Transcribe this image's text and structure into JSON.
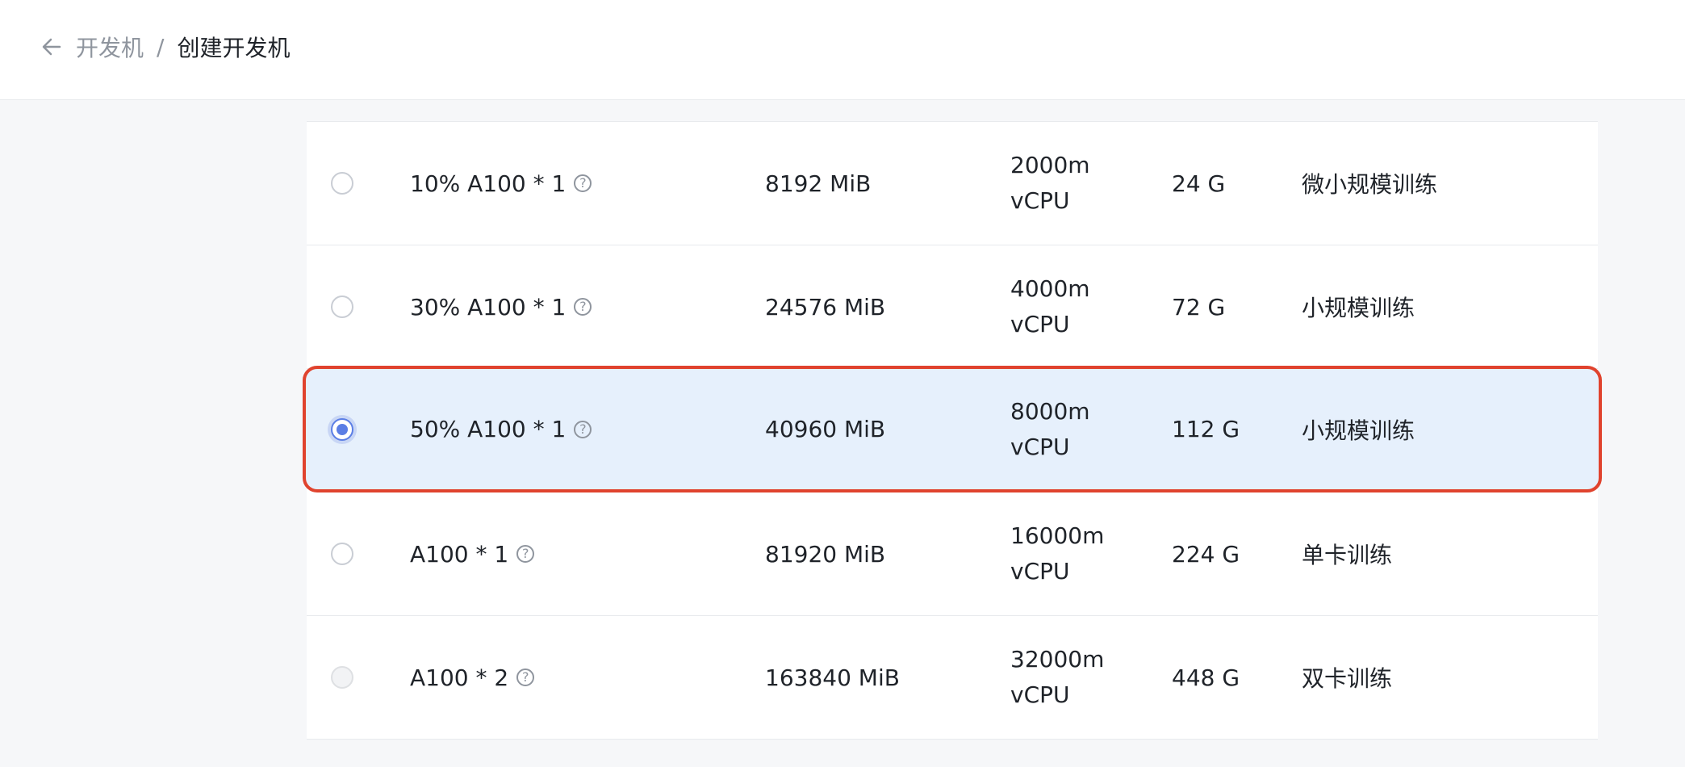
{
  "header": {
    "back_icon": "arrow-left-icon",
    "parent_label": "开发机",
    "separator": "/",
    "current_label": "创建开发机"
  },
  "rows": [
    {
      "spec": "10% A100 * 1",
      "memory": "8192 MiB",
      "cpu_line1": "2000m",
      "cpu_line2": "vCPU",
      "disk": "24 G",
      "usage": "微小规模训练",
      "selected": false,
      "disabled": false
    },
    {
      "spec": "30% A100 * 1",
      "memory": "24576 MiB",
      "cpu_line1": "4000m",
      "cpu_line2": "vCPU",
      "disk": "72 G",
      "usage": "小规模训练",
      "selected": false,
      "disabled": false
    },
    {
      "spec": "50% A100 * 1",
      "memory": "40960 MiB",
      "cpu_line1": "8000m",
      "cpu_line2": "vCPU",
      "disk": "112 G",
      "usage": "小规模训练",
      "selected": true,
      "disabled": false
    },
    {
      "spec": "A100 * 1",
      "memory": "81920 MiB",
      "cpu_line1": "16000m",
      "cpu_line2": "vCPU",
      "disk": "224 G",
      "usage": "单卡训练",
      "selected": false,
      "disabled": false
    },
    {
      "spec": "A100 * 2",
      "memory": "163840 MiB",
      "cpu_line1": "32000m",
      "cpu_line2": "vCPU",
      "disk": "448 G",
      "usage": "双卡训练",
      "selected": false,
      "disabled": true
    }
  ],
  "help_icon_glyph": "?",
  "colors": {
    "selected_row_bg": "#e6f0fc",
    "highlight_border": "#e0432e",
    "radio_checked": "#5b7ee5"
  }
}
